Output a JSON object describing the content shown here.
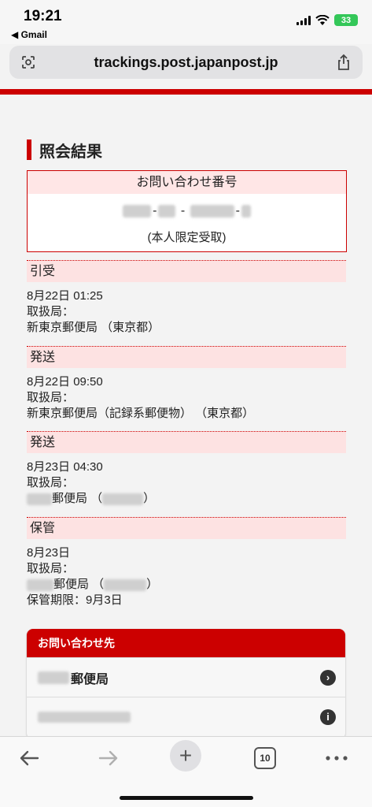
{
  "status_bar": {
    "time": "19:21",
    "back_app": "◀ Gmail",
    "battery": "33"
  },
  "browser": {
    "url": "trackings.post.japanpost.jp"
  },
  "page": {
    "heading": "照会結果",
    "inquiry": {
      "title": "お問い合わせ番号",
      "note": "(本人限定受取)"
    },
    "events": [
      {
        "status": "引受",
        "datetime": "8月22日 01:25",
        "office_label": "取扱局：",
        "office": "新東京郵便局 （東京都）"
      },
      {
        "status": "発送",
        "datetime": "8月22日 09:50",
        "office_label": "取扱局：",
        "office": "新東京郵便局（記録系郵便物） （東京都）"
      },
      {
        "status": "発送",
        "datetime": "8月23日 04:30",
        "office_label": "取扱局：",
        "office_suffix": "郵便局 （",
        "office_close": "）"
      },
      {
        "status": "保管",
        "datetime": "8月23日",
        "office_label": "取扱局：",
        "office_suffix": "郵便局 （",
        "office_close": "）",
        "deadline": "保管期限：9月3日"
      }
    ],
    "contact": {
      "title": "お問い合わせ先",
      "office_suffix": "郵便局"
    }
  },
  "toolbar": {
    "tab_count": "10"
  },
  "colors": {
    "accent": "#cc0000",
    "event_bg": "#fde2e2",
    "battery": "#34c759"
  }
}
